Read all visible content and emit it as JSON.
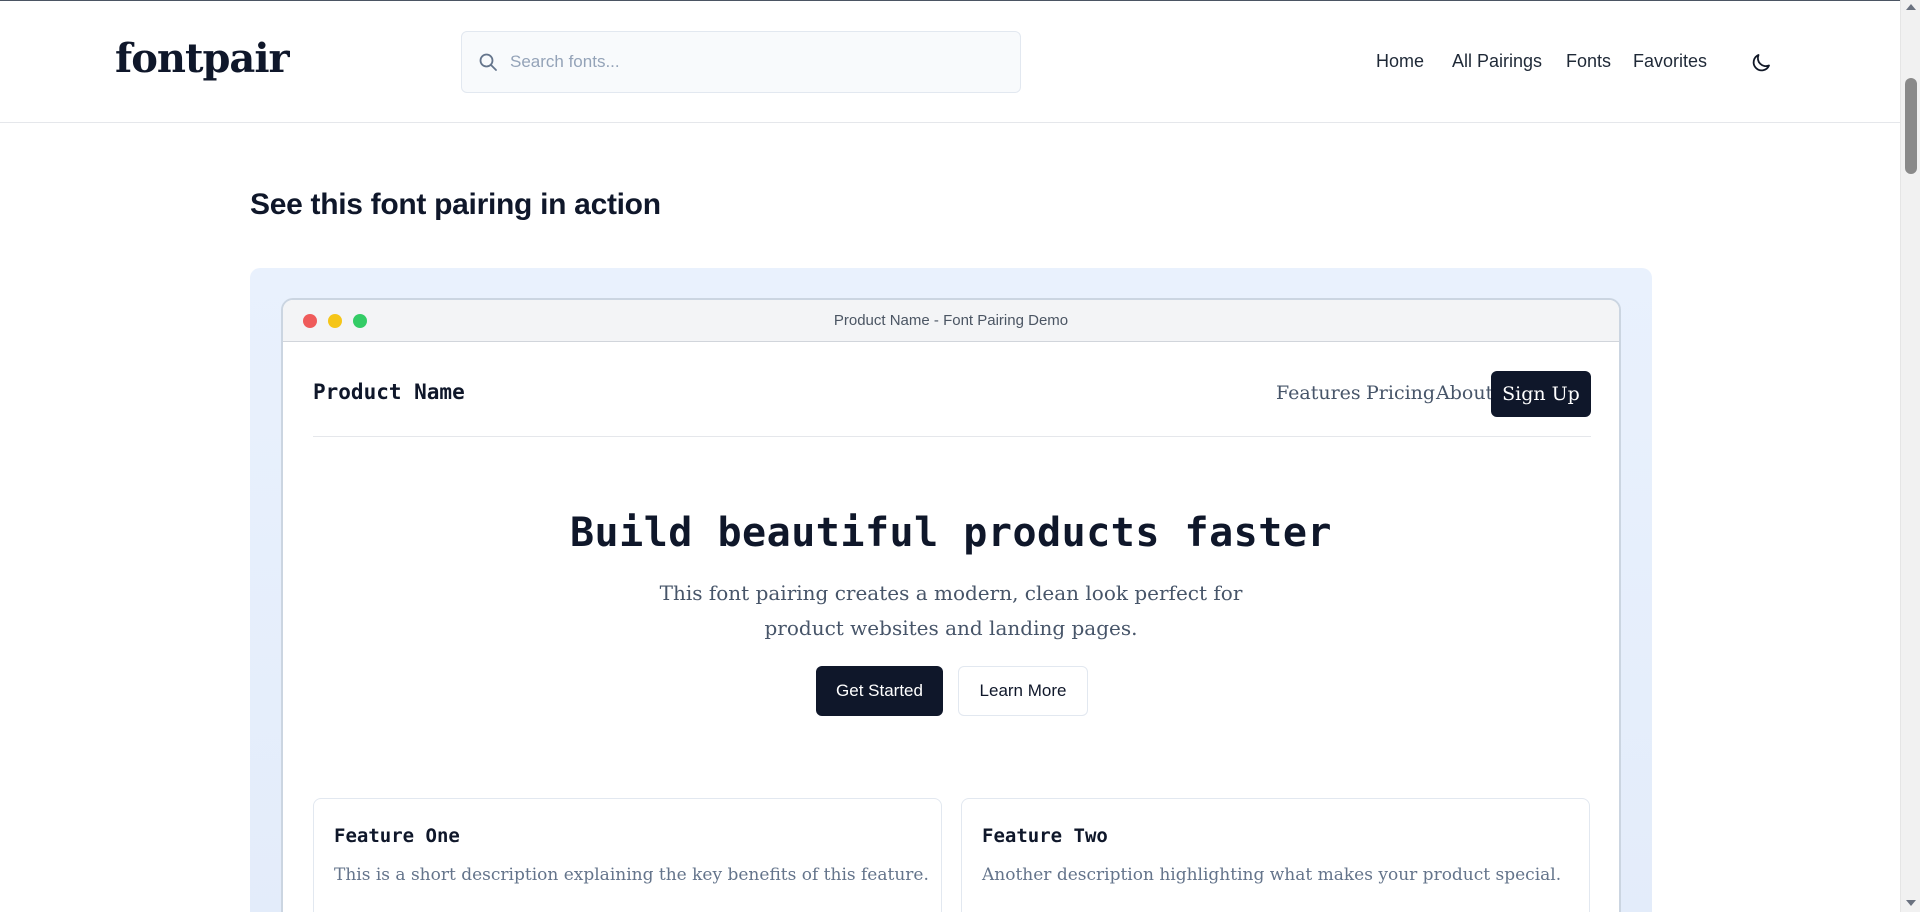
{
  "header": {
    "logo": "fontpair",
    "search": {
      "placeholder": "Search fonts...",
      "icon": "search-icon"
    },
    "nav": [
      {
        "label": "Home"
      },
      {
        "label": "All Pairings"
      },
      {
        "label": "Fonts"
      },
      {
        "label": "Favorites"
      }
    ],
    "theme_toggle_icon": "moon-icon"
  },
  "section": {
    "title": "See this font pairing in action"
  },
  "preview": {
    "window_title": "Product Name - Font Pairing Demo",
    "window_controls": [
      "close-dot",
      "minimize-dot",
      "maximize-dot"
    ],
    "demo": {
      "brand": "Product Name",
      "links": [
        {
          "label": "Features"
        },
        {
          "label": "Pricing"
        },
        {
          "label": "About"
        }
      ],
      "signup": "Sign Up",
      "hero": {
        "title": "Build beautiful products faster",
        "subtitle": "This font pairing creates a modern, clean look perfect for product websites and landing pages.",
        "primary_cta": "Get Started",
        "secondary_cta": "Learn More"
      },
      "features": [
        {
          "title": "Feature One",
          "description": "This is a short description explaining the key benefits of this feature."
        },
        {
          "title": "Feature Two",
          "description": "Another description highlighting what makes your product special."
        }
      ]
    }
  },
  "colors": {
    "brand_dark": "#0f172a",
    "muted_text": "#475569",
    "preview_background": "#e9f1fd",
    "dot_red": "#ef5b5b",
    "dot_yellow": "#f5c518",
    "dot_green": "#33cc66"
  }
}
